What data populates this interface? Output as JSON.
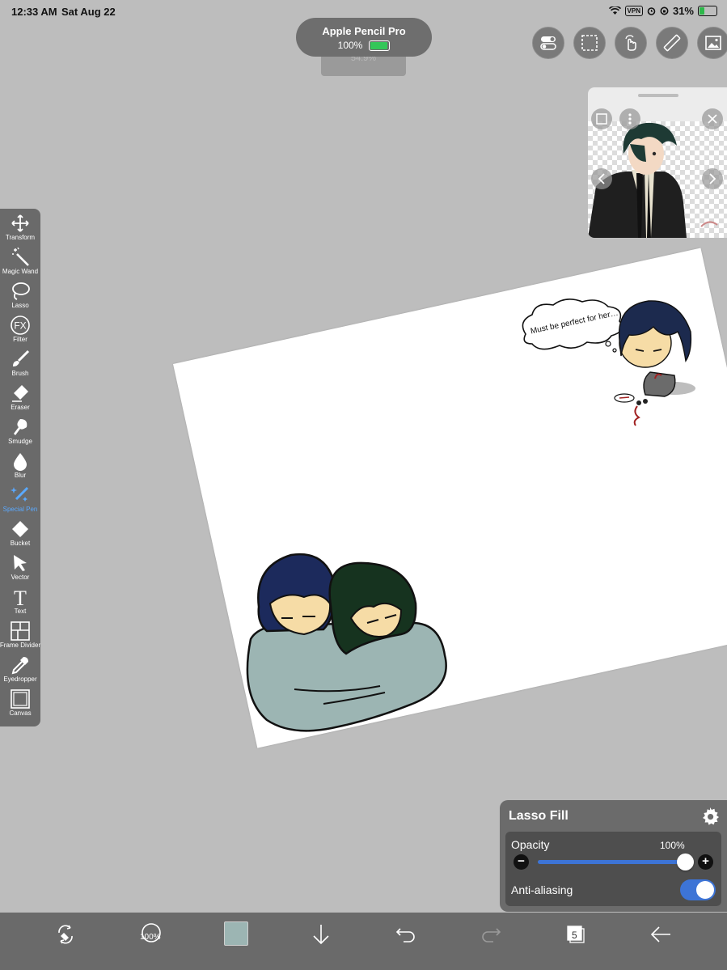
{
  "status_bar": {
    "time": "12:33 AM",
    "date": "Sat Aug 22",
    "vpn_label": "VPN",
    "battery_percent": "31%",
    "icons": [
      "wifi-icon",
      "vpn-icon",
      "alarm-icon",
      "rotation-lock-icon",
      "battery-charging-icon"
    ]
  },
  "pencil_popup": {
    "title": "Apple Pencil Pro",
    "battery": "100%",
    "ghost_text": "54.9%"
  },
  "top_buttons": [
    "toggle-settings-icon",
    "selection-icon",
    "gesture-hand-icon",
    "ruler-icon",
    "image-reference-icon"
  ],
  "reference_window": {
    "buttons": [
      "frame-icon",
      "more-icon",
      "close-icon",
      "prev-icon",
      "next-icon"
    ]
  },
  "toolbar": {
    "tools": [
      {
        "label": "Transform",
        "icon": "transform-icon"
      },
      {
        "label": "Magic Wand",
        "icon": "magic-wand-icon"
      },
      {
        "label": "Lasso",
        "icon": "lasso-icon"
      },
      {
        "label": "Filter",
        "icon": "fx-icon"
      },
      {
        "label": "Brush",
        "icon": "brush-icon"
      },
      {
        "label": "Eraser",
        "icon": "eraser-icon"
      },
      {
        "label": "Smudge",
        "icon": "smudge-icon"
      },
      {
        "label": "Blur",
        "icon": "blur-drop-icon"
      },
      {
        "label": "Special Pen",
        "icon": "special-pen-icon",
        "active": true
      },
      {
        "label": "Bucket",
        "icon": "bucket-icon"
      },
      {
        "label": "Vector",
        "icon": "vector-arrow-icon"
      },
      {
        "label": "Text",
        "icon": "text-icon"
      },
      {
        "label": "Frame Divider",
        "icon": "frame-divider-icon"
      },
      {
        "label": "Eyedropper",
        "icon": "eyedropper-icon"
      },
      {
        "label": "Canvas",
        "icon": "canvas-icon"
      }
    ]
  },
  "artwork": {
    "thought_text": "Must be perfect for her…"
  },
  "lasso_fill_panel": {
    "title": "Lasso Fill",
    "opacity_label": "Opacity",
    "opacity_value": "100%",
    "opacity_level": 1.0,
    "anti_aliasing_label": "Anti-aliasing",
    "anti_aliasing_on": true
  },
  "bottom_bar": {
    "brush_size_label": "100%",
    "current_color": "#9cb5b3",
    "layer_count": "5",
    "icons": [
      "swap-tool-icon",
      "brush-size-icon",
      "color-swatch",
      "download-arrow-icon",
      "undo-icon",
      "redo-icon",
      "layers-icon",
      "back-arrow-icon"
    ]
  },
  "colors": {
    "background": "#bdbdbd",
    "panel": "#6a6a6a",
    "accent": "#3d74d6",
    "active_tool": "#5aa9ff"
  }
}
